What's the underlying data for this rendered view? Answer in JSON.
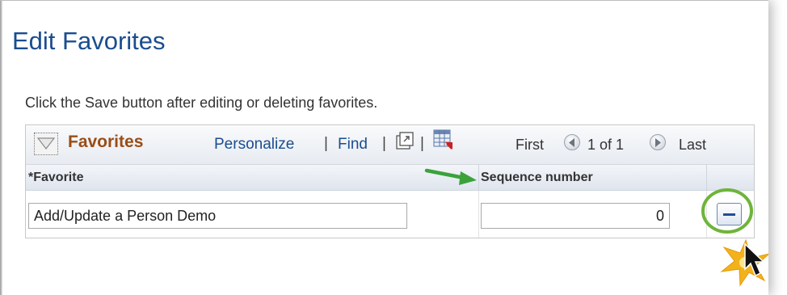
{
  "page": {
    "title": "Edit Favorites",
    "instruction": "Click the Save button after editing or deleting favorites."
  },
  "grid": {
    "title": "Favorites",
    "personalize_label": "Personalize",
    "find_label": "Find",
    "separator": "|",
    "nav": {
      "first_label": "First",
      "count_label": "1 of 1",
      "last_label": "Last"
    },
    "columns": {
      "favorite": "*Favorite",
      "sequence": "Sequence number"
    },
    "rows": [
      {
        "favorite": "Add/Update a Person Demo",
        "sequence": "0"
      }
    ],
    "icons": {
      "collapse": "collapse-triangle-icon",
      "view_all": "new-window-icon",
      "download": "download-to-excel-icon",
      "previous": "previous-arrow-icon",
      "next": "next-arrow-icon",
      "delete": "delete-row-icon"
    }
  },
  "annotations": {
    "arrow_color": "#3ba23b",
    "circle_color": "#6fb43a",
    "starburst_color": "#f2b21c"
  },
  "colors": {
    "title_blue": "#1a4d8f",
    "grid_title_brown": "#9a4d16",
    "link_blue": "#1a4d8f"
  }
}
